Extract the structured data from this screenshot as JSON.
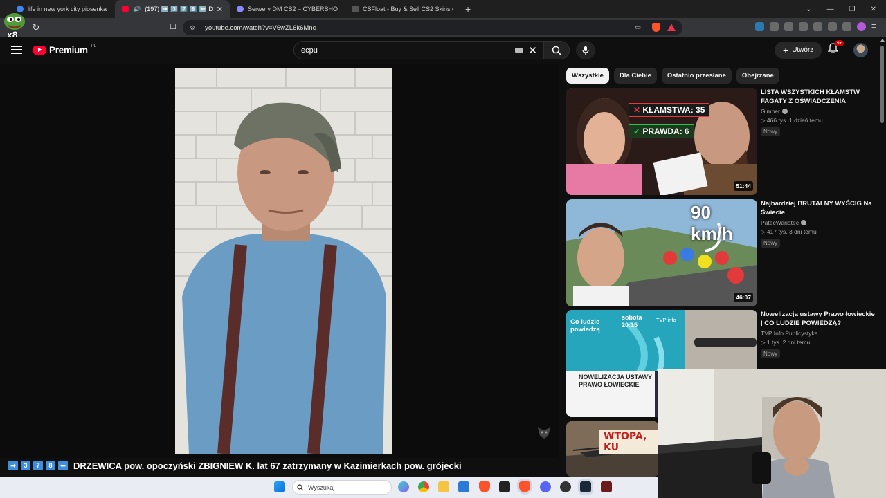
{
  "browser": {
    "tabs": [
      {
        "title": "life in new york city piosenka - Goog",
        "active": false,
        "color": "#4285f4"
      },
      {
        "title": "(197) ➡️ 3️⃣ 7️⃣ 8️⃣ ⬅️ DRZEW",
        "active": true,
        "color": "#ff0033"
      },
      {
        "title": "Serwery DM CS2 – CYBERSHOKE",
        "active": false,
        "color": "#8a8aff"
      },
      {
        "title": "CSFloat - Buy & Sell CS2 Skins on the",
        "active": false,
        "color": "#dddddd"
      }
    ],
    "url": "youtube.com/watch?v=V6wZL6k6Mnc",
    "pepe_label": "x8"
  },
  "header": {
    "logo_text": "Premium",
    "country_code": "PL",
    "search_value": "ecpu",
    "create_label": "Utwórz",
    "notification_count": "9+"
  },
  "video": {
    "title_prefix": [
      "3",
      "7",
      "8"
    ],
    "title": "DRZEWICA pow. opoczyński ZBIGNIEW K. lat 67 zatrzymany w Kazimierkach pow. grójecki"
  },
  "chips": [
    "Wszystkie",
    "Dla Ciebie",
    "Ostatnio przesłane",
    "Obejrzane"
  ],
  "recommendations": [
    {
      "title": "LISTA WSZYSTKICH KŁAMSTW FAGATY Z OŚWIADCZENIA",
      "channel": "Gimper",
      "stats": "▷ 466 tys.   1 dzień temu",
      "badge": "Nowy",
      "duration": "51:44",
      "thumb_text_1": "KŁAMSTWA: 35",
      "thumb_text_2": "PRAWDA: 6"
    },
    {
      "title": "Najbardziej BRUTALNY WYŚCIG Na Świecie",
      "channel": "PatecWariatec",
      "stats": "▷ 417 tys.   3 dni temu",
      "badge": "Nowy",
      "duration": "46:07",
      "thumb_text_1": "90 km/h"
    },
    {
      "title": "Nowelizacja ustawy Prawo łowieckie | CO LUDZIE POWIEDZĄ?",
      "channel": "TVP Info Publicystyka",
      "stats": "▷ 1 tys.   2 dni temu",
      "badge": "Nowy",
      "thumb_text_1": "Co ludzie powiedzą",
      "thumb_text_2": "sobota 20:15",
      "thumb_text_3": "TVP info",
      "thumb_text_4": "NOWELIZACJA USTAWY PRAWO ŁOWIECKIE"
    }
  ],
  "partial_rec_text": "WTOPA, KU",
  "taskbar": {
    "search_placeholder": "Wyszukaj"
  },
  "colors": {
    "yt_red": "#ff0033",
    "background": "#0f0f0f",
    "chip": "#272727"
  }
}
